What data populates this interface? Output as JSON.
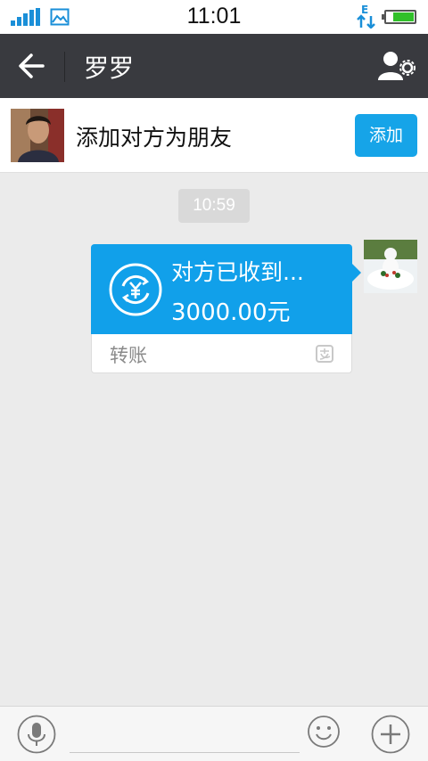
{
  "status_bar": {
    "time": "11:01",
    "data_indicator": "E",
    "icons": [
      "signal-icon",
      "picture-notification-icon",
      "data-transfer-icon",
      "battery-icon"
    ]
  },
  "header": {
    "title": "罗罗",
    "back_icon": "back-arrow-icon",
    "profile_icon": "contact-settings-icon"
  },
  "add_friend_bar": {
    "text": "添加对方为朋友",
    "button_label": "添加"
  },
  "chat": {
    "timestamp": "10:59",
    "transfer": {
      "title": "对方已收到...",
      "amount": "3000.00元",
      "label": "转账",
      "icon": "yuan-transfer-icon"
    }
  },
  "input_bar": {
    "placeholder": "",
    "icons": [
      "microphone-icon",
      "emoji-icon",
      "plus-icon"
    ]
  },
  "colors": {
    "title_bar": "#393a3f",
    "accent_blue": "#11a0ea",
    "add_button": "#16a4e8",
    "chat_background": "#ebebeb"
  }
}
